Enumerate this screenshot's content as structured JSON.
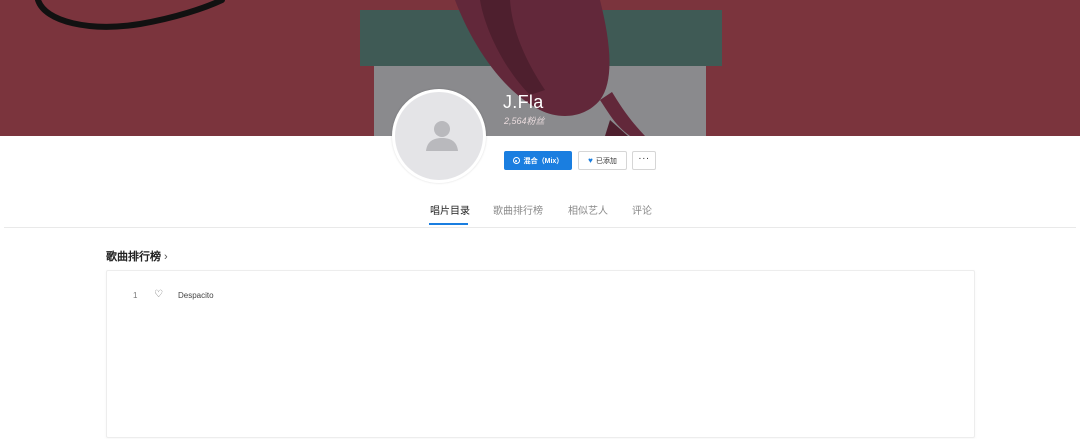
{
  "artist": {
    "name": "J.Fla",
    "fans": "2,564粉丝"
  },
  "actions": {
    "mix_label": "混合（Mix）",
    "add_label": "已添加",
    "more_label": "···"
  },
  "tabs": [
    {
      "label": "唱片目录",
      "active": true
    },
    {
      "label": "歌曲排行榜",
      "active": false
    },
    {
      "label": "相似艺人",
      "active": false
    },
    {
      "label": "评论",
      "active": false
    }
  ],
  "top_songs": {
    "title": "歌曲排行榜",
    "chevron": "›",
    "items": [
      {
        "rank": "1",
        "title": "Despacito"
      }
    ]
  },
  "colors": {
    "banner_bg": "#7b343d",
    "accent": "#1a7ee0"
  },
  "icons": {
    "avatar": "person-placeholder-icon",
    "mix": "radio-icon",
    "added": "heart-filled-icon",
    "song_like": "heart-outline-icon",
    "more": "ellipsis-icon"
  }
}
